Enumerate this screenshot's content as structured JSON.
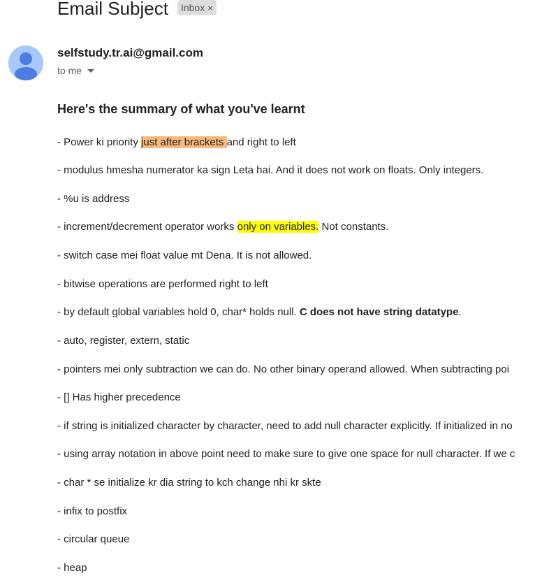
{
  "subject": "Email Subject",
  "label": {
    "text": "Inbox",
    "close": "×"
  },
  "sender": {
    "email": "selfstudy.tr.ai@gmail.com",
    "recipient": "to me"
  },
  "heading": "Here's the summary of what you've learnt",
  "lines": {
    "l1": {
      "a": "- Power ki priority ",
      "hl": "just after brackets ",
      "b": "and right to left"
    },
    "l2": "- modulus hmesha numerator ka sign Leta hai. And it does not work on floats. Only integers.",
    "l3": "- %u is address",
    "l4": {
      "a": "- increment/decrement operator works ",
      "hl": "only on variables.",
      "b": " Not constants."
    },
    "l5": "- switch case mei float value mt Dena. It is not allowed.",
    "l6": "- bitwise operations are performed right to left",
    "l7": {
      "a": "- by default global variables hold 0, char* holds null. ",
      "bold": "C does not have string datatype",
      "b": "."
    },
    "l8": "- auto, register, extern, static",
    "l9": "- pointers mei only subtraction we can do. No other binary operand allowed. When subtracting poi",
    "l10": "- [] Has higher precedence",
    "l11": "- if string is initialized character by character, need to add null character explicitly. If initialized in no",
    "l12": "- using array notation in above point need to make sure to give one space for null character. If we c",
    "l13": "- char * se initialize kr dia string to kch change nhi kr skte",
    "l14": "- infix to postfix",
    "l15": "- circular queue",
    "l16": "- heap"
  },
  "colors": {
    "highlight_orange": "#f9b97a",
    "highlight_yellow": "#ffff00",
    "avatar": "#a8c7fa",
    "avatar_figure": "#4a7ee0"
  },
  "icons": {
    "avatar": "person-avatar-icon",
    "dropdown": "caret-down-icon",
    "chip_close": "close-icon"
  }
}
